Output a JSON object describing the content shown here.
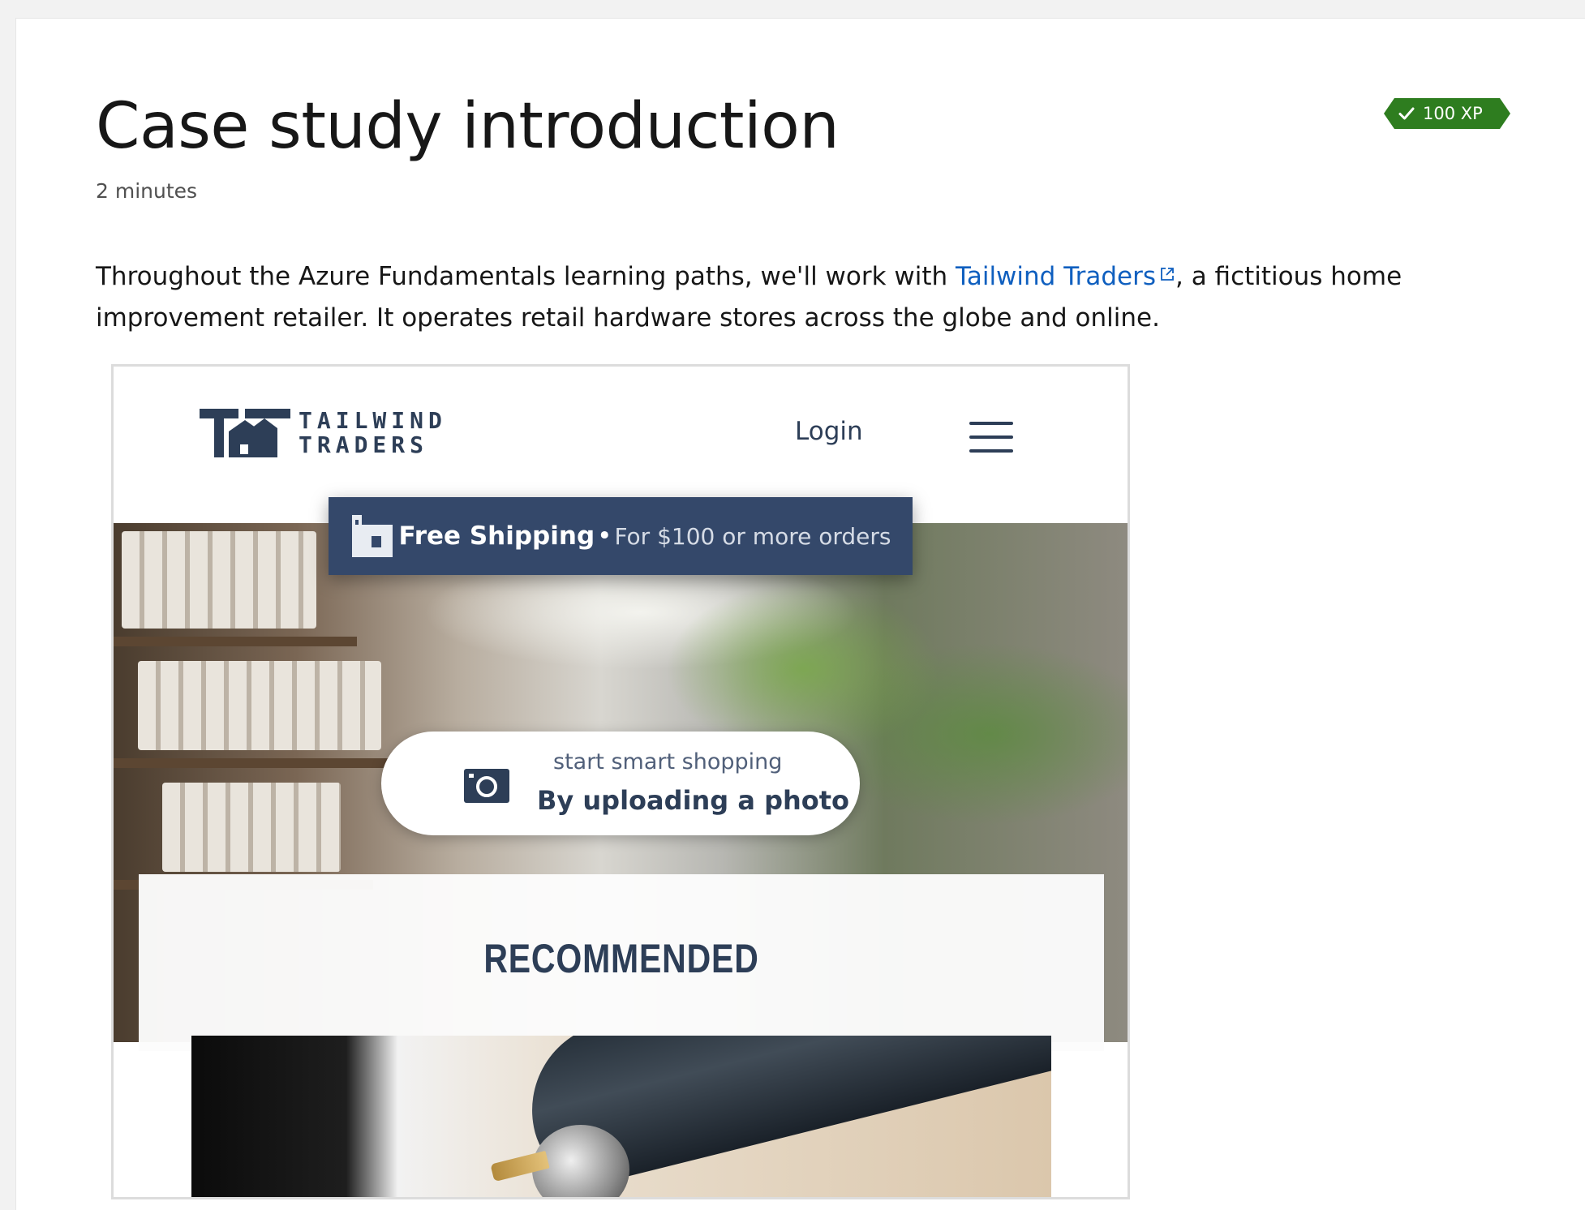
{
  "page": {
    "title": "Case study introduction",
    "duration": "2 minutes",
    "xp_badge": "100 XP"
  },
  "intro": {
    "text_before": "Throughout the Azure Fundamentals learning paths, we'll work with ",
    "link_text": "Tailwind Traders",
    "text_after": ", a fictitious home improvement retailer. It operates retail hardware stores across the globe and online."
  },
  "figure": {
    "logo_line1": "TAILWIND",
    "logo_line2": "TRADERS",
    "login": "Login",
    "shipping_strong": "Free Shipping",
    "shipping_dot": "•",
    "shipping_sub": "For $100 or more orders",
    "pill_top": "start smart shopping",
    "pill_bottom": "By uploading a photo",
    "recommended": "RECOMMENDED"
  },
  "icons": {
    "xp_check": "check-icon",
    "external_link": "external-link-icon",
    "logo": "tailwind-logo-icon",
    "menu": "hamburger-menu-icon",
    "store": "store-icon",
    "camera": "camera-icon"
  },
  "colors": {
    "xp_badge": "#2e7d1f",
    "link": "#0f5fbf",
    "brand_navy": "#2d3e57",
    "banner": "#34486a"
  }
}
